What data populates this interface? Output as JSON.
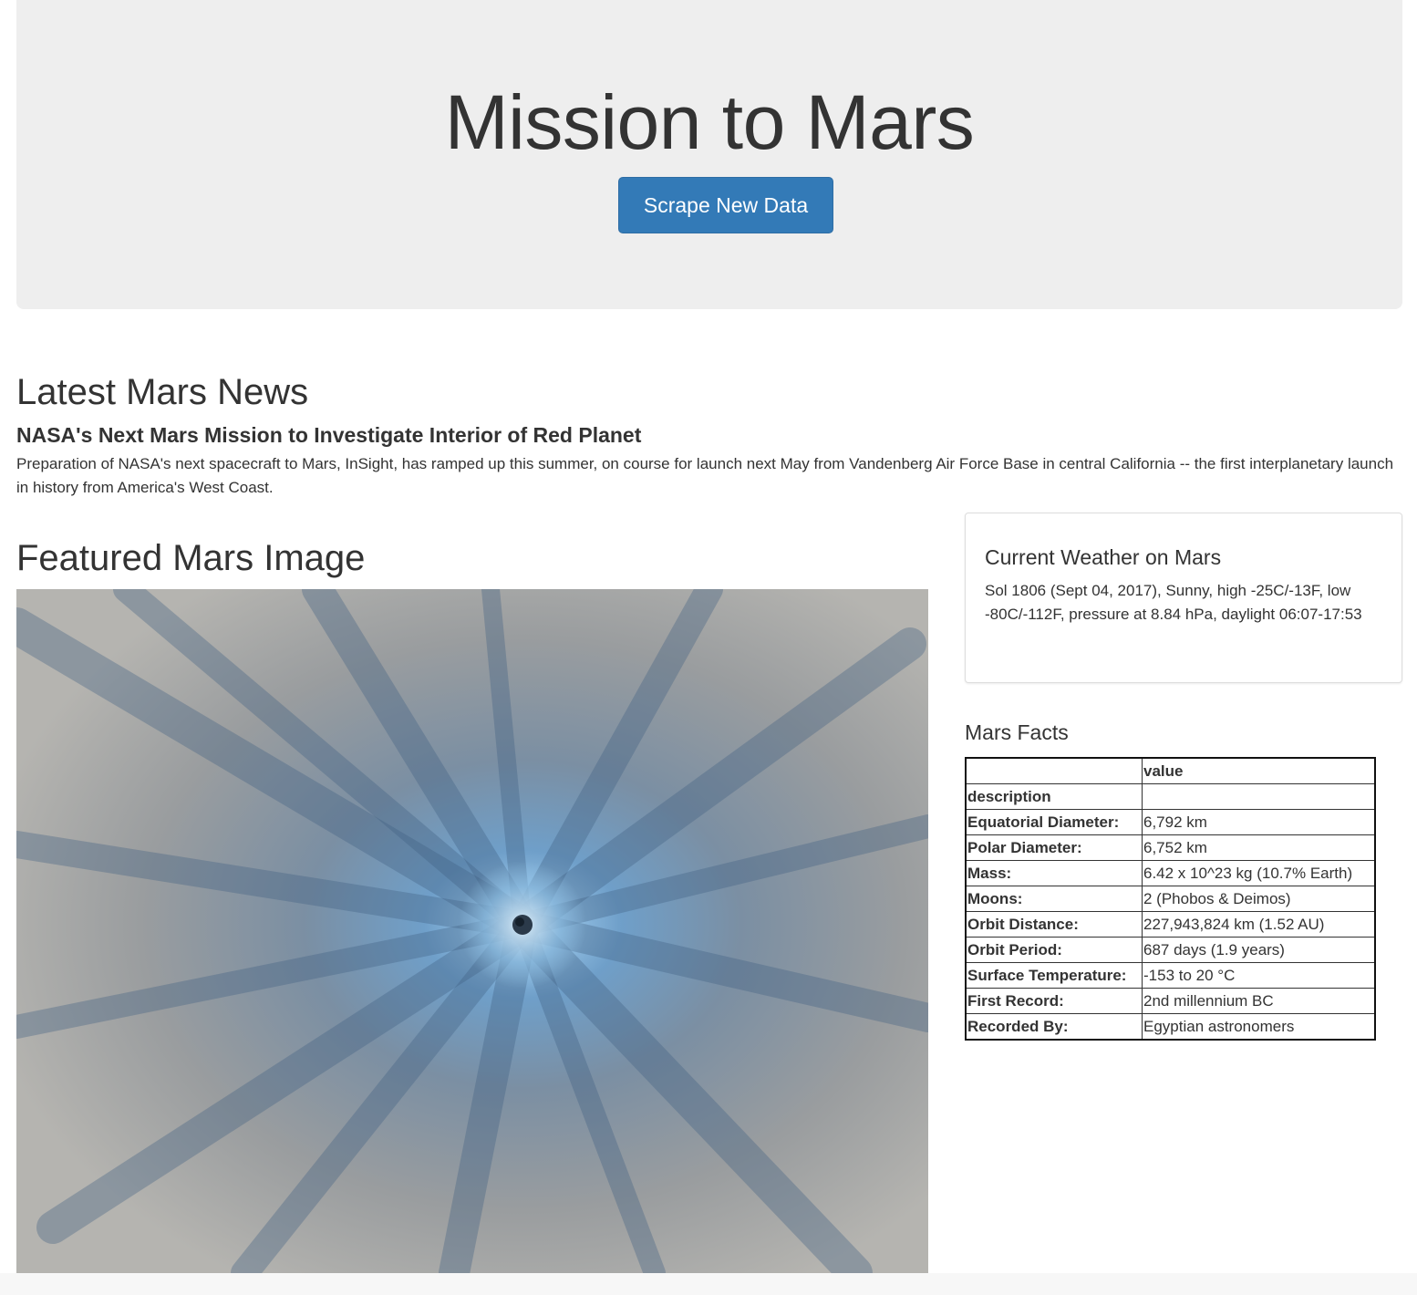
{
  "header": {
    "title": "Mission to Mars",
    "scrape_button": "Scrape New Data"
  },
  "news": {
    "heading": "Latest Mars News",
    "title": "NASA's Next Mars Mission to Investigate Interior of Red Planet",
    "paragraph": "Preparation of NASA's next spacecraft to Mars, InSight, has ramped up this summer, on course for launch next May from Vandenberg Air Force Base in central California -- the first interplanetary launch in history from America's West Coast."
  },
  "featured": {
    "heading": "Featured Mars Image"
  },
  "weather": {
    "heading": "Current Weather on Mars",
    "text": "Sol 1806 (Sept 04, 2017), Sunny, high -25C/-13F, low -80C/-112F, pressure at 8.84 hPa, daylight 06:07-17:53"
  },
  "facts": {
    "heading": "Mars Facts",
    "header_blank": "",
    "header_value": "value",
    "index_label": "description",
    "rows": [
      {
        "key": "Equatorial Diameter:",
        "value": "6,792 km"
      },
      {
        "key": "Polar Diameter:",
        "value": "6,752 km"
      },
      {
        "key": "Mass:",
        "value": "6.42 x 10^23 kg (10.7% Earth)"
      },
      {
        "key": "Moons:",
        "value": "2 (Phobos & Deimos)"
      },
      {
        "key": "Orbit Distance:",
        "value": "227,943,824 km (1.52 AU)"
      },
      {
        "key": "Orbit Period:",
        "value": "687 days (1.9 years)"
      },
      {
        "key": "Surface Temperature:",
        "value": "-153 to 20 °C"
      },
      {
        "key": "First Record:",
        "value": "2nd millennium BC"
      },
      {
        "key": "Recorded By:",
        "value": "Egyptian astronomers"
      }
    ]
  },
  "colors": {
    "jumbotron": "#eeeeee",
    "button": "#337ab7"
  }
}
